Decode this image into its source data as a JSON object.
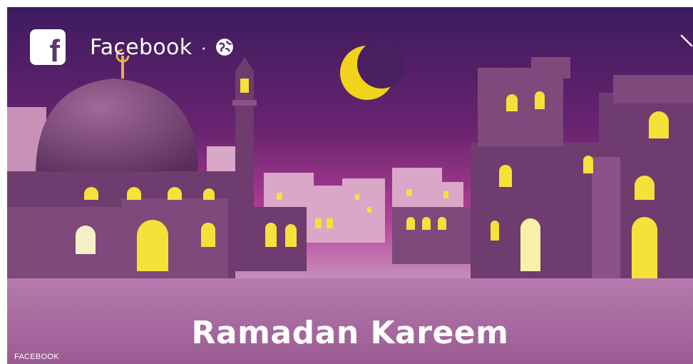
{
  "post": {
    "source_name": "Facebook",
    "separator": "·",
    "audience_icon": "globe-icon",
    "page_icon": "facebook-f-icon",
    "collapse_icon": "chevron-icon"
  },
  "image": {
    "caption": "Ramadan Kareem",
    "credit": "FACEBOOK",
    "colors": {
      "sky_top": "#3d1b5e",
      "sky_mid": "#7a2a7a",
      "sky_glow": "#c0409a",
      "ground": "#b87ab0",
      "building": "#6e3c6e",
      "building_light": "#8a5288",
      "window_light": "#f4e23a",
      "moon": "#f2d21a"
    }
  }
}
